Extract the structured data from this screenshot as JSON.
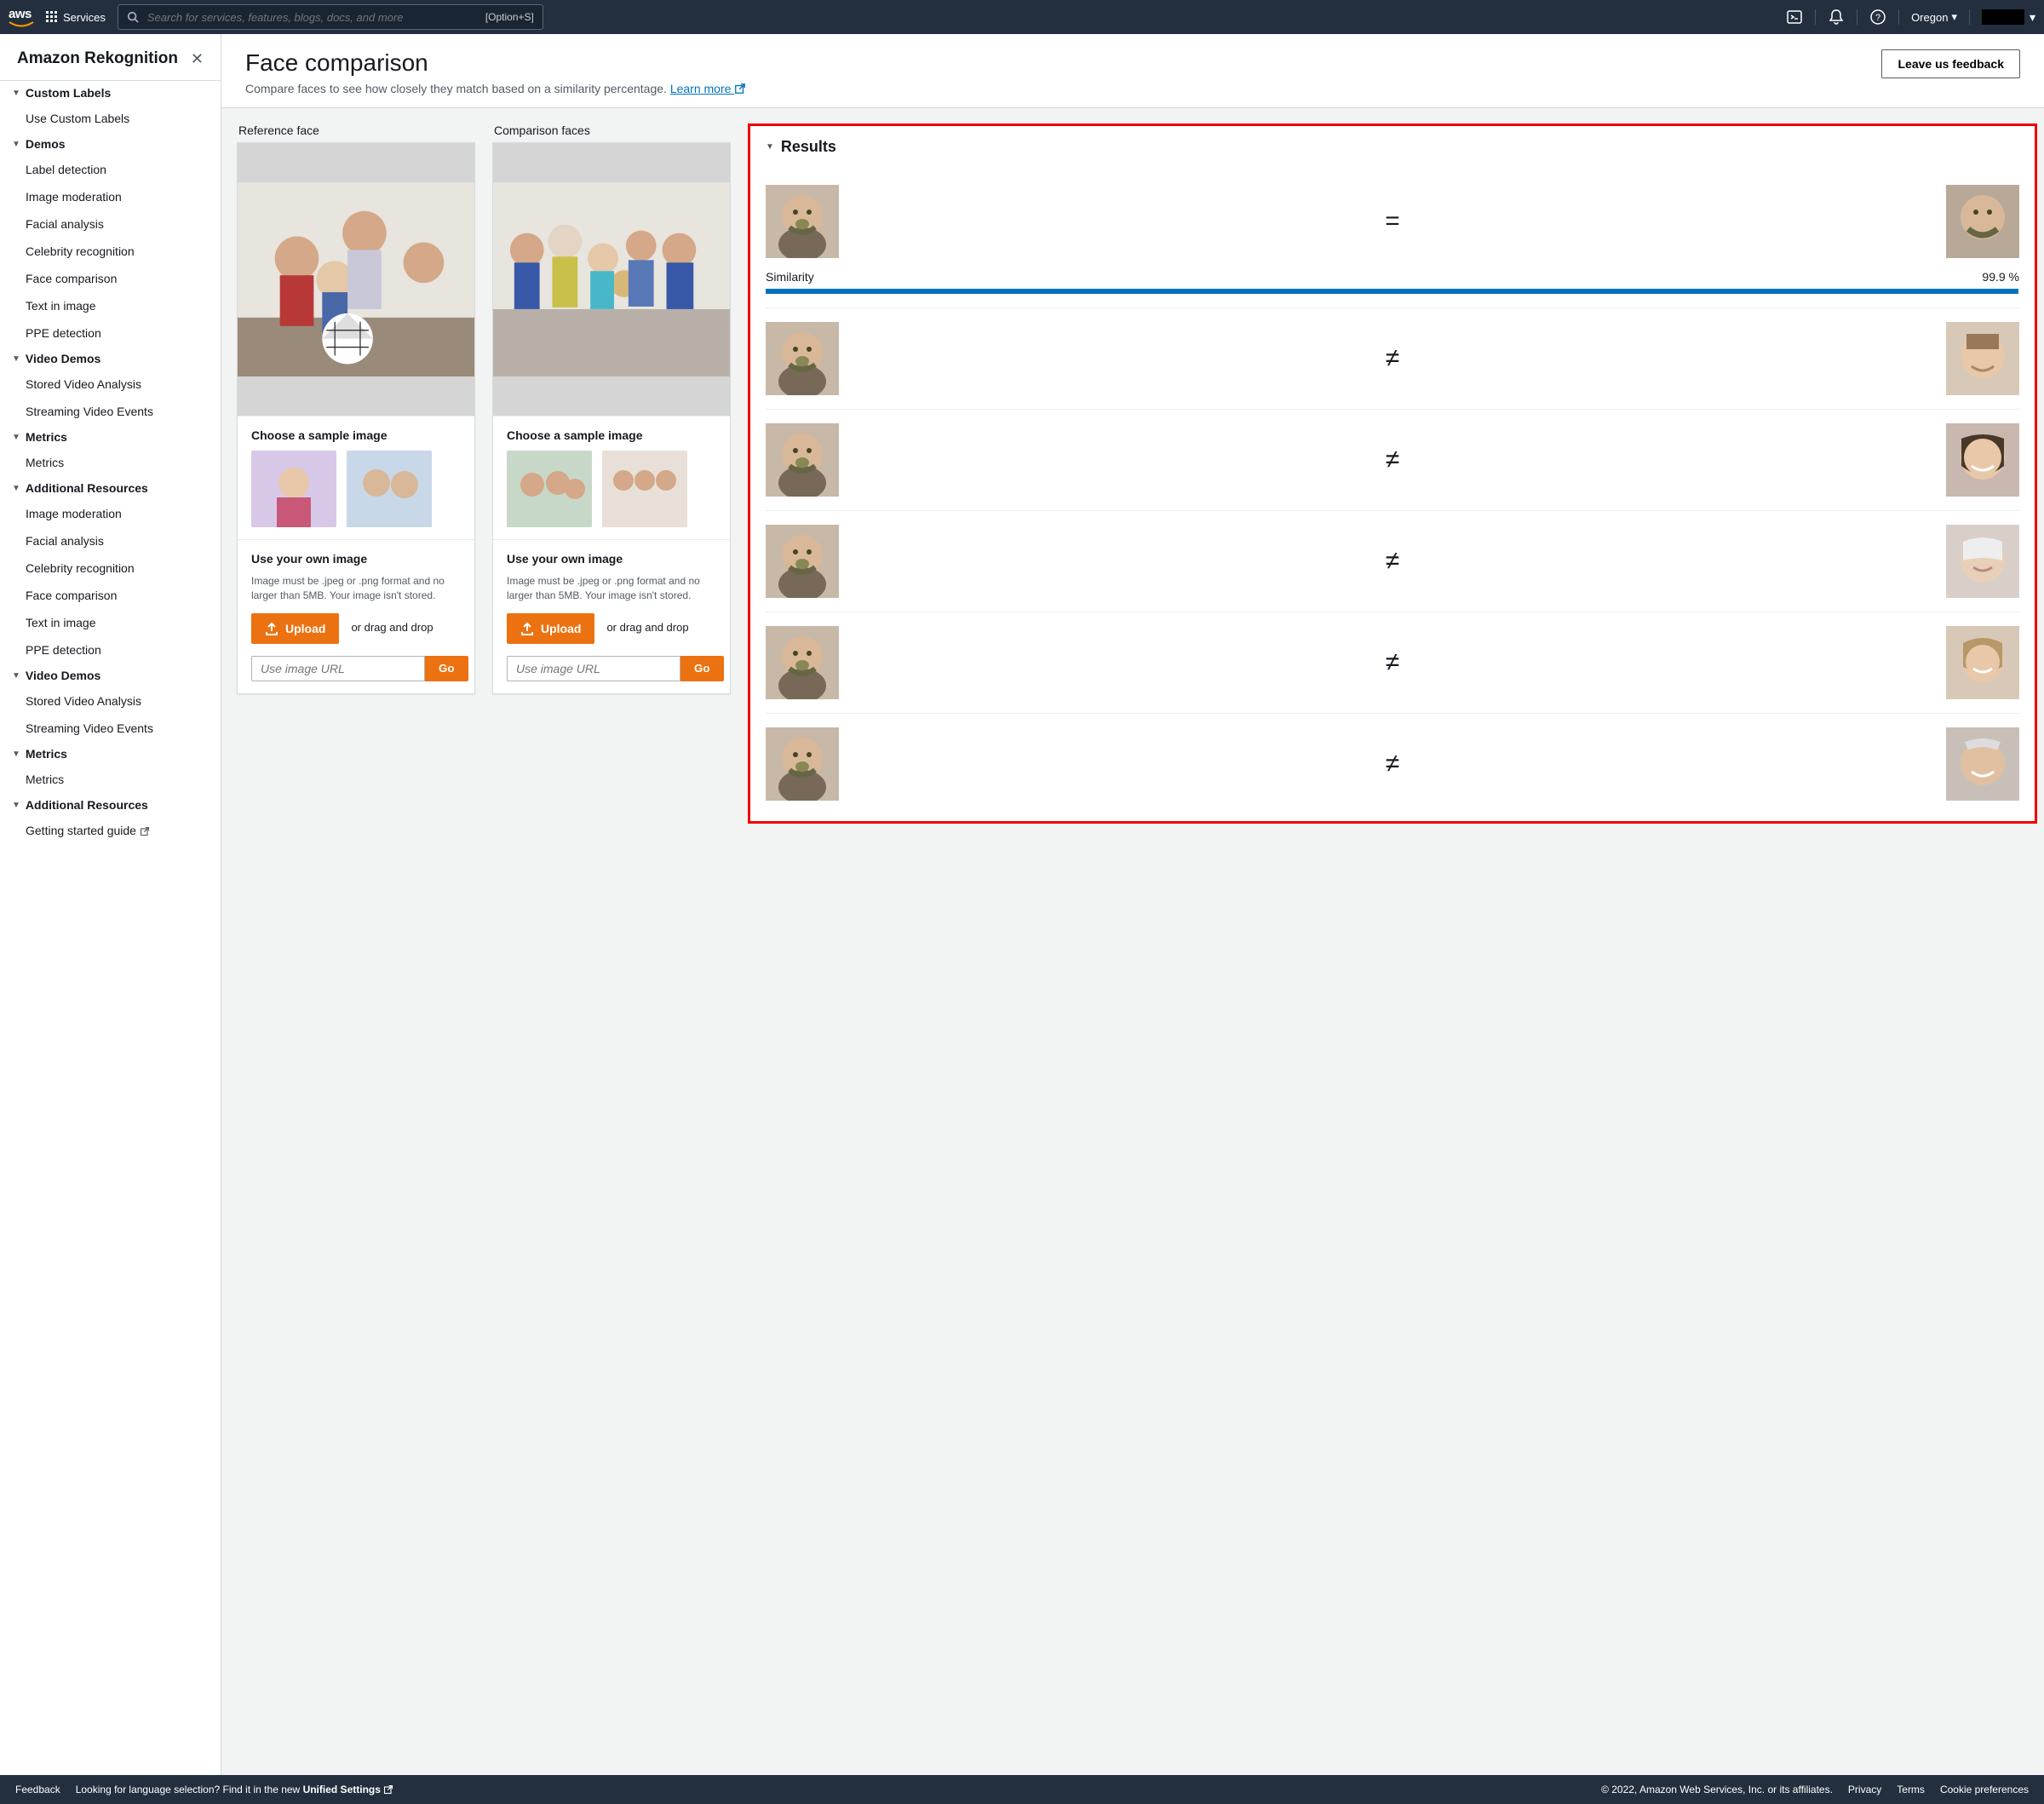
{
  "topnav": {
    "logo_text": "aws",
    "services_label": "Services",
    "search_placeholder": "Search for services, features, blogs, docs, and more",
    "search_shortcut": "[Option+S]",
    "region": "Oregon"
  },
  "sidebar": {
    "title": "Amazon Rekognition",
    "sections": [
      {
        "heading": "Custom Labels",
        "items": [
          "Use Custom Labels"
        ]
      },
      {
        "heading": "Demos",
        "items": [
          "Label detection",
          "Image moderation",
          "Facial analysis",
          "Celebrity recognition",
          "Face comparison",
          "Text in image",
          "PPE detection"
        ]
      },
      {
        "heading": "Video Demos",
        "items": [
          "Stored Video Analysis",
          "Streaming Video Events"
        ]
      },
      {
        "heading": "Metrics",
        "items": [
          "Metrics"
        ]
      },
      {
        "heading": "Additional Resources",
        "items": [
          "Image moderation",
          "Facial analysis",
          "Celebrity recognition",
          "Face comparison",
          "Text in image",
          "PPE detection"
        ]
      },
      {
        "heading": "Video Demos",
        "items": [
          "Stored Video Analysis",
          "Streaming Video Events"
        ]
      },
      {
        "heading": "Metrics",
        "items": [
          "Metrics"
        ]
      },
      {
        "heading": "Additional Resources",
        "items_ext": [
          "Getting started guide"
        ]
      }
    ]
  },
  "page": {
    "title": "Face comparison",
    "description": "Compare faces to see how closely they match based on a similarity percentage.",
    "learn_more": "Learn more",
    "feedback_button": "Leave us feedback"
  },
  "panels": {
    "reference": {
      "label": "Reference face",
      "sample_heading": "Choose a sample image",
      "own_heading": "Use your own image",
      "own_hint": "Image must be .jpeg or .png format and no larger than 5MB. Your image isn't stored.",
      "upload_label": "Upload",
      "drag_text": "or drag and drop",
      "url_placeholder": "Use image URL",
      "go_label": "Go"
    },
    "comparison": {
      "label": "Comparison faces",
      "sample_heading": "Choose a sample image",
      "own_heading": "Use your own image",
      "own_hint": "Image must be .jpeg or .png format and no larger than 5MB. Your image isn't stored.",
      "upload_label": "Upload",
      "drag_text": "or drag and drop",
      "url_placeholder": "Use image URL",
      "go_label": "Go"
    }
  },
  "results": {
    "heading": "Results",
    "similarity_label": "Similarity",
    "items": [
      {
        "match": true,
        "symbol": "=",
        "similarity_text": "99.9 %",
        "similarity_bar_pct": 99.9
      },
      {
        "match": false,
        "symbol": "≠"
      },
      {
        "match": false,
        "symbol": "≠"
      },
      {
        "match": false,
        "symbol": "≠"
      },
      {
        "match": false,
        "symbol": "≠"
      },
      {
        "match": false,
        "symbol": "≠"
      }
    ]
  },
  "footer": {
    "feedback": "Feedback",
    "lang_hint": "Looking for language selection? Find it in the new",
    "unified": "Unified Settings",
    "copyright": "© 2022, Amazon Web Services, Inc. or its affiliates.",
    "links": [
      "Privacy",
      "Terms",
      "Cookie preferences"
    ]
  }
}
